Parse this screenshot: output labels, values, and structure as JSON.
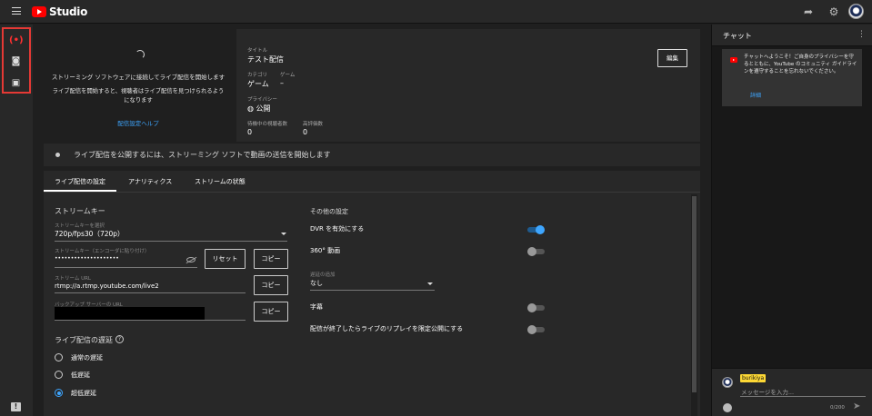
{
  "topbar": {
    "app_name": "Studio",
    "icons": {
      "menu": "menu-icon",
      "share": "share-icon",
      "settings": "gear-icon",
      "account": "avatar"
    }
  },
  "leftbar": {
    "items": [
      {
        "name": "live-icon",
        "glyph": "(•)"
      },
      {
        "name": "camera-icon",
        "glyph": "◙"
      },
      {
        "name": "calendar-icon",
        "glyph": "▣"
      }
    ],
    "feedback_glyph": "!"
  },
  "preview": {
    "message": "ストリーミング ソフトウェアに接続してライブ配信を開始します",
    "sub_message": "ライブ配信を開始すると、視聴者はライブ配信を見つけられるようになります",
    "help_link": "配信設定ヘルプ"
  },
  "info": {
    "title_label": "タイトル",
    "title": "テスト配信",
    "category_label": "カテゴリ",
    "category": "ゲーム",
    "game_label": "ゲーム",
    "game": "–",
    "privacy_label": "プライバシー",
    "privacy": "公開",
    "waiting_label": "待機中の視聴者数",
    "waiting": "0",
    "likes_label": "高評価数",
    "likes": "0",
    "edit_button": "編集"
  },
  "status": {
    "text": "ライブ配信を公開するには、ストリーミング ソフトで動画の送信を開始します"
  },
  "tabs": [
    "ライブ配信の設定",
    "アナリティクス",
    "ストリームの状態"
  ],
  "stream_key": {
    "section_title": "ストリームキー",
    "select_label": "ストリームキーを選択",
    "select_value": "720p/fps30（720p）",
    "key_label": "ストリームキー（エンコーダに貼り付け）",
    "key_value": "••••••••••••••••••••",
    "reset_button": "リセット",
    "copy_button": "コピー",
    "url_label": "ストリーム URL",
    "url_value": "rtmp://a.rtmp.youtube.com/live2",
    "backup_label": "バックアップ サーバーの URL"
  },
  "latency": {
    "title": "ライブ配信の遅延",
    "options": [
      "通常の遅延",
      "低遅延",
      "超低遅延"
    ],
    "selected_index": 2
  },
  "other_settings": {
    "title": "その他の設定",
    "dvr_label": "DVR を有効にする",
    "dvr_on": true,
    "v360_label": "360° 動画",
    "v360_on": false,
    "delay_label": "遅延の追加",
    "delay_value": "なし",
    "captions_label": "字幕",
    "captions_on": false,
    "unlisted_label": "配信が終了したらライブのリプレイを限定公開にする",
    "unlisted_on": false
  },
  "chat": {
    "title": "チャット",
    "notice": "チャットへようこそ！ご自身のプライバシーを守るとともに、YouTube のコミュニティ ガイドラインを遵守することを忘れないでください。",
    "notice_link": "詳細",
    "author": "burikiya",
    "placeholder": "メッセージを入力...",
    "counter": "0/200"
  },
  "colors": {
    "accent": "#3ea6ff",
    "brand_red": "#ff0000",
    "highlight": "#e53935"
  }
}
